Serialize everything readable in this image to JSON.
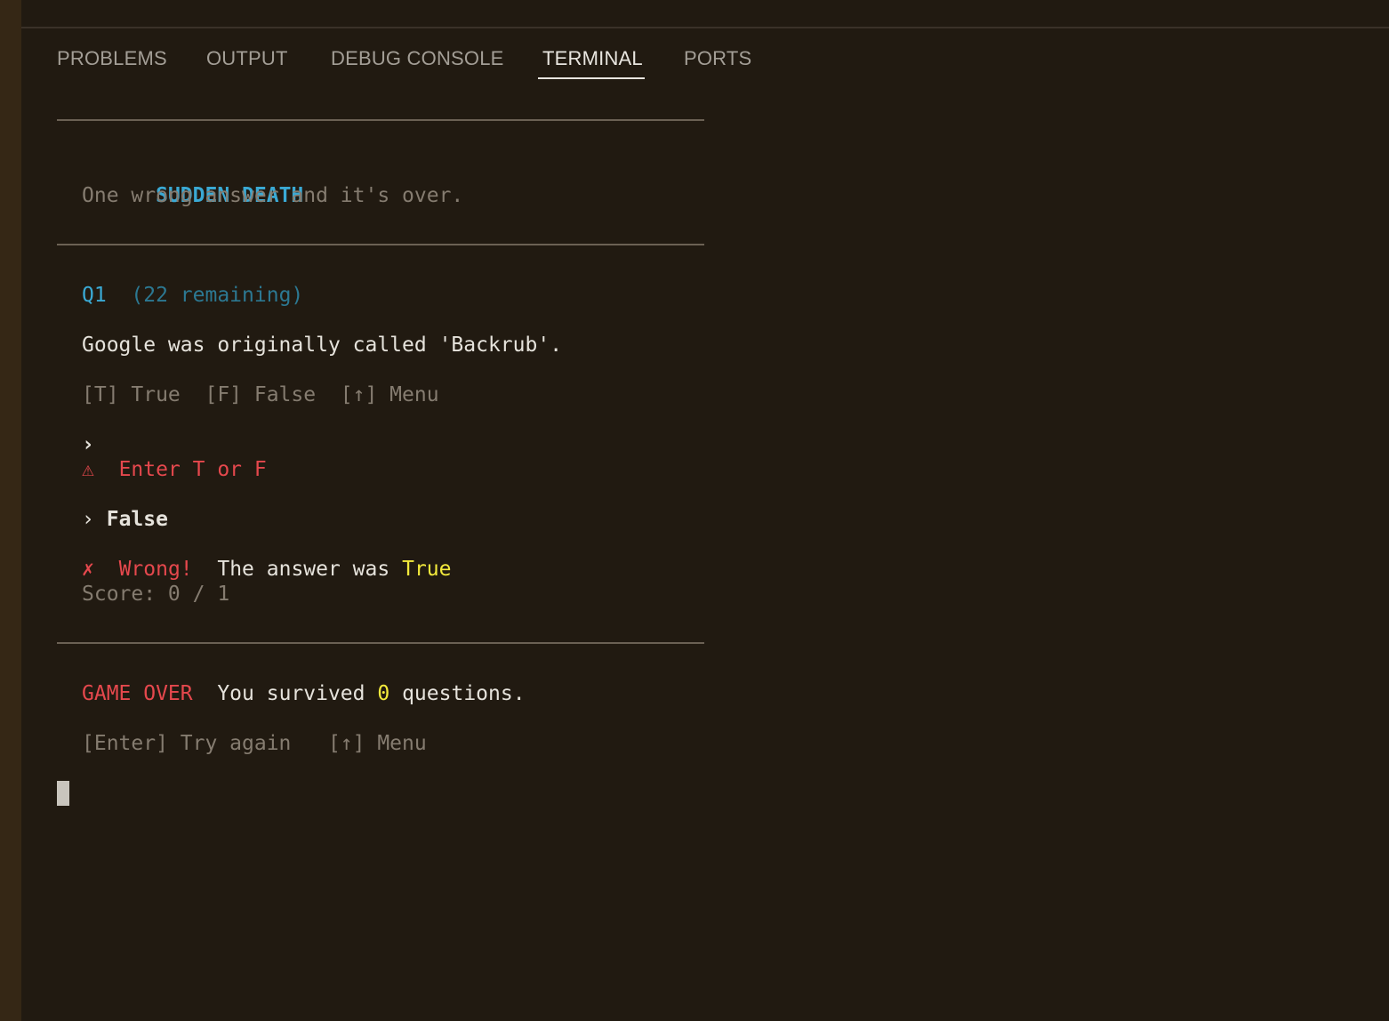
{
  "panel": {
    "tabs": [
      {
        "label": "PROBLEMS",
        "active": false
      },
      {
        "label": "OUTPUT",
        "active": false
      },
      {
        "label": "DEBUG CONSOLE",
        "active": false
      },
      {
        "label": "TERMINAL",
        "active": true
      },
      {
        "label": "PORTS",
        "active": false
      }
    ]
  },
  "terminal": {
    "header": {
      "title": "SUDDEN DEATH",
      "subtitle": "One wrong answer and it's over."
    },
    "question": {
      "number": "Q1",
      "remaining": "(22 remaining)",
      "text": "Google was originally called 'Backrub'.",
      "options": "[T] True  [F] False  [↑] Menu"
    },
    "first_prompt": "›",
    "warning": {
      "icon": "⚠",
      "text": "Enter T or F"
    },
    "answer": {
      "prompt": "›",
      "value": "False"
    },
    "result": {
      "icon": "✗",
      "label": "Wrong!",
      "text": "The answer was",
      "correct": "True",
      "score": "Score: 0 / 1"
    },
    "game_over": {
      "label": "GAME OVER",
      "text_before": "You survived",
      "count": "0",
      "text_after": "questions.",
      "options": "[Enter] Try again   [↑] Menu"
    }
  },
  "colors": {
    "background": "#211a11",
    "accent_cyan": "#3aa9d4",
    "error_red": "#e5484d",
    "highlight_yellow": "#f3ea3c",
    "dim_text": "#857c70"
  }
}
